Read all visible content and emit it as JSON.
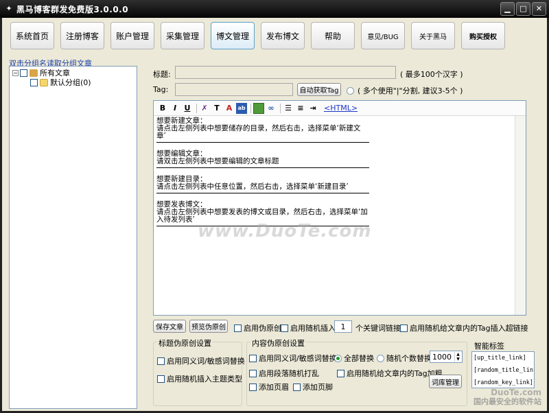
{
  "window": {
    "title": "黑马博客群发免费版3.0.0.0"
  },
  "nav": [
    {
      "label": "系统首页"
    },
    {
      "label": "注册博客"
    },
    {
      "label": "账户管理"
    },
    {
      "label": "采集管理"
    },
    {
      "label": "博文管理"
    },
    {
      "label": "发布博文"
    },
    {
      "label": "帮助"
    },
    {
      "label": "意见/BUG"
    },
    {
      "label": "关于黑马"
    },
    {
      "label": "购买授权"
    }
  ],
  "tree": {
    "hint": "双击分组名读取分组文章",
    "root": "所有文章",
    "child": "默认分组(0)"
  },
  "form": {
    "title_label": "标题:",
    "title_hint": "( 最多100个汉字 )",
    "tag_label": "Tag:",
    "auto_tag_button": "自动获取Tag",
    "tag_hint": "( 多个使用\"|\"分割, 建议3-5个 )"
  },
  "toolbar": {
    "html_link": "<HTML>"
  },
  "editor": {
    "paragraphs": [
      {
        "line1": "想要新建文章：",
        "line2": "请点击左侧列表中想要储存的目录，然后右击，选择菜单‘新建文章’"
      },
      {
        "line1": "想要编辑文章：",
        "line2": "请双击左侧列表中想要编辑的文章标题"
      },
      {
        "line1": "想要新建目录：",
        "line2": "请点击左侧列表中任意位置，然后右击，选择菜单‘新建目录’"
      },
      {
        "line1": "想要发表博文：",
        "line2": "请点击左侧列表中想要发表的博文或目录，然后右击，选择菜单‘加入待发列表’"
      }
    ]
  },
  "actions": {
    "save": "保存文章",
    "preview": "预览伪原创",
    "enable_fake": "启用伪原创",
    "enable_random_insert": "启用随机插入",
    "keyword_count": "1",
    "keyword_link": "个关键词链接",
    "random_tag_link": "启用随机给文章内的Tag插入超链接"
  },
  "title_fake": {
    "group_title": "标题伪原创设置",
    "synonym": "启用同义词/敏感词替换",
    "random_topic": "启用随机插入主题类型"
  },
  "content_fake": {
    "group_title": "内容伪原创设置",
    "synonym": "启用同义词/敏感词替换",
    "replace_all": "全部替换",
    "replace_random": "随机个数替换",
    "random_count": "1000",
    "shuffle": "启用段落随机打乱",
    "tag_bold": "启用随机给文章内的Tag加粗",
    "add_header": "添加页眉",
    "add_footer": "添加页脚",
    "dict_button": "词库管理"
  },
  "smart_tags": {
    "title": "智能标签",
    "items": [
      "[up_title_link]",
      "[random_title_link]",
      "[random_key_link]"
    ]
  },
  "watermarks": {
    "center": "www.DuoTe.com",
    "corner1": "DuoTe.com",
    "corner2": "国内最安全的软件站"
  }
}
